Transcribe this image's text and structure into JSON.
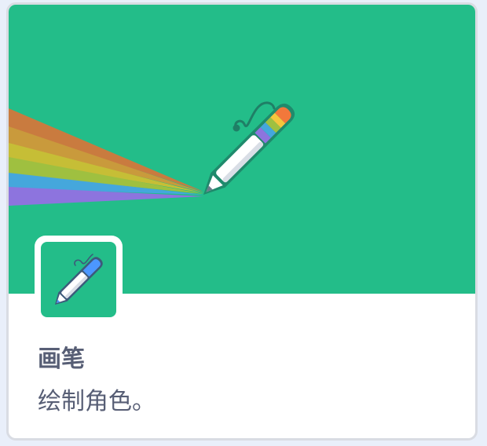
{
  "extension": {
    "title": "画笔",
    "description": "绘制角色。"
  },
  "colors": {
    "banner_background": "#23bd89",
    "text": "#575e75",
    "card_border": "#d9dce3",
    "page_background": "#e9effa",
    "pen_accent": "#4c97ff"
  },
  "icons": {
    "banner": "rainbow-pen-icon",
    "thumbnail": "pen-icon"
  }
}
